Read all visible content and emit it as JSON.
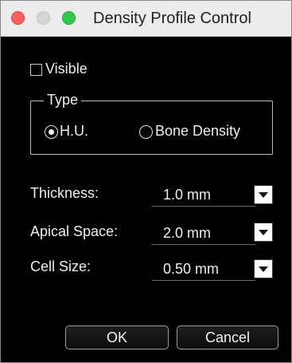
{
  "window": {
    "title": "Density Profile Control"
  },
  "visible_checkbox": {
    "label": "Visible",
    "checked": false
  },
  "type_group": {
    "title": "Type",
    "options": [
      {
        "label": "H.U.",
        "selected": true
      },
      {
        "label": "Bone Density",
        "selected": false
      }
    ]
  },
  "settings": [
    {
      "label": "Thickness:",
      "value": "1.0 mm"
    },
    {
      "label": "Apical Space:",
      "value": "2.0 mm"
    },
    {
      "label": "Cell Size:",
      "value": "0.50 mm"
    }
  ],
  "buttons": {
    "ok": "OK",
    "cancel": "Cancel"
  },
  "colors": {
    "background": "#000000",
    "text": "#eeeeee",
    "close": "#fc605c",
    "minimize": "#d6d6d6",
    "maximize": "#34c84a"
  }
}
